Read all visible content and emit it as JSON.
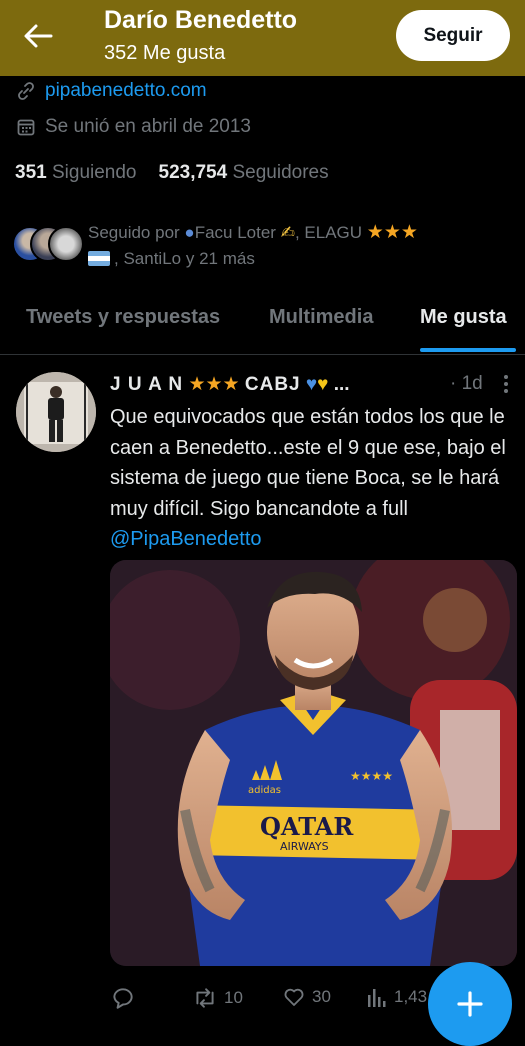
{
  "header": {
    "name": "Darío Benedetto",
    "likes_count": "352 Me gusta",
    "follow_label": "Seguir"
  },
  "profile": {
    "website": "pipabenedetto.com",
    "joined": "Se unió en abril de 2013",
    "following_count": "351",
    "following_label": "Siguiendo",
    "followers_count": "523,754",
    "followers_label": "Seguidores",
    "followed_by_prefix": "Seguido por",
    "followed_by_user1": "Facu Loter",
    "followed_by_user2": "ELAGU",
    "followed_by_user3": "SantiLo",
    "followed_by_suffix": "y 21 más"
  },
  "tabs": [
    {
      "label": "Tweets y respuestas"
    },
    {
      "label": "Multimedia"
    },
    {
      "label": "Me gusta"
    }
  ],
  "tweet": {
    "author": "J U A N",
    "author_suffix": "CABJ",
    "time": "· 1d",
    "text": "Que equivocados que están todos los que le caen a Benedetto...este el 9 que ese, bajo el sistema de juego que tiene Boca, se le hará muy difícil. Sigo bancandote a full",
    "mention": "@PipaBenedetto",
    "jersey_sponsor_top": "QATAR",
    "jersey_sponsor_bottom": "AIRWAYS",
    "jersey_brand": "adidas",
    "retweets": "10",
    "likes": "30",
    "views": "1,43"
  },
  "colors": {
    "header_bg": "#7d6a0e",
    "accent": "#1d9bf0",
    "background": "#000000",
    "muted_text": "#71767b"
  }
}
